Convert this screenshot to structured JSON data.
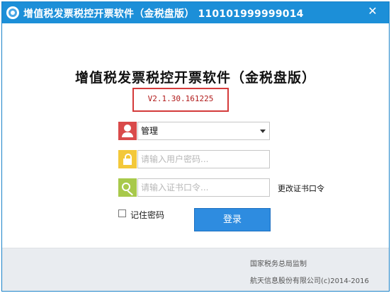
{
  "window": {
    "title": "增值税发票税控开票软件（金税盘版） 110101999999014",
    "close_symbol": "✕"
  },
  "main": {
    "heading": "增值税发票税控开票软件（金税盘版）",
    "version": "V2.1.30.161225"
  },
  "form": {
    "user_value": "管理",
    "password_placeholder": "请输入用户密码...",
    "cert_placeholder": "请输入证书口令...",
    "change_cert_link": "更改证书口令",
    "remember_label": "记住密码",
    "login_label": "登录"
  },
  "footer": {
    "supervisor": "国家税务总局监制",
    "copyright": "航天信息股份有限公司(c)2014-2016"
  },
  "icons": {
    "app": "app-logo-icon",
    "user": "user-icon",
    "password": "lock-icon",
    "cert": "key-icon"
  },
  "colors": {
    "titlebar": "#1c8fd8",
    "user_icon_bg": "#d94a4a",
    "lock_icon_bg": "#f3c83a",
    "key_icon_bg": "#a8c94b",
    "login_button": "#2e8ce0",
    "version_highlight": "#d43a3a"
  }
}
